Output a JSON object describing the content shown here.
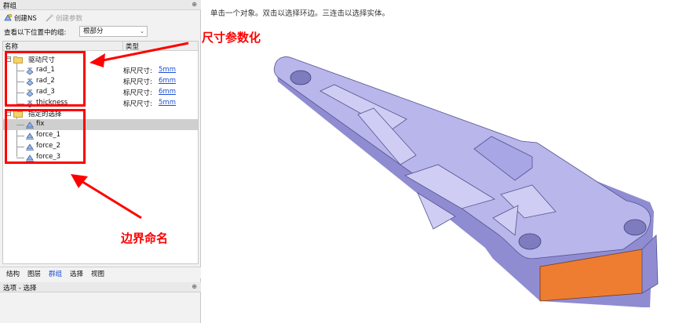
{
  "panel": {
    "title": "群组",
    "pin_icon": "pin-icon"
  },
  "toolbar": {
    "create_ns_label": "创建NS",
    "create_param_label": "创建参数"
  },
  "filter": {
    "label": "查看以下位置中的组:",
    "selected": "根部分"
  },
  "columns": {
    "name": "名称",
    "type": "类型"
  },
  "tree": {
    "group1": {
      "label": "驱动尺寸",
      "items": [
        {
          "label": "rad_1",
          "type_label": "标尺尺寸:",
          "value": "5mm"
        },
        {
          "label": "rad_2",
          "type_label": "标尺尺寸:",
          "value": "6mm"
        },
        {
          "label": "rad_3",
          "type_label": "标尺尺寸:",
          "value": "6mm"
        },
        {
          "label": "thickness",
          "type_label": "标尺尺寸:",
          "value": "5mm"
        }
      ]
    },
    "group2": {
      "label": "指定的选择",
      "items": [
        {
          "label": "fix"
        },
        {
          "label": "force_1"
        },
        {
          "label": "force_2"
        },
        {
          "label": "force_3"
        }
      ]
    }
  },
  "tabs": [
    "结构",
    "图层",
    "群组",
    "选择",
    "视图"
  ],
  "active_tab": "群组",
  "options_panel": {
    "title": "选项 - 选择"
  },
  "viewport": {
    "hint": "单击一个对象。双击以选择环边。三连击以选择实体。"
  },
  "annotations": {
    "top_label": "尺寸参数化",
    "bottom_label": "边界命名",
    "color": "#ff0000"
  },
  "colors": {
    "part_face": "#b8b6ea",
    "part_side": "#8f8cd2",
    "highlight_face": "#ee7d32",
    "link": "#1a4fd6"
  }
}
